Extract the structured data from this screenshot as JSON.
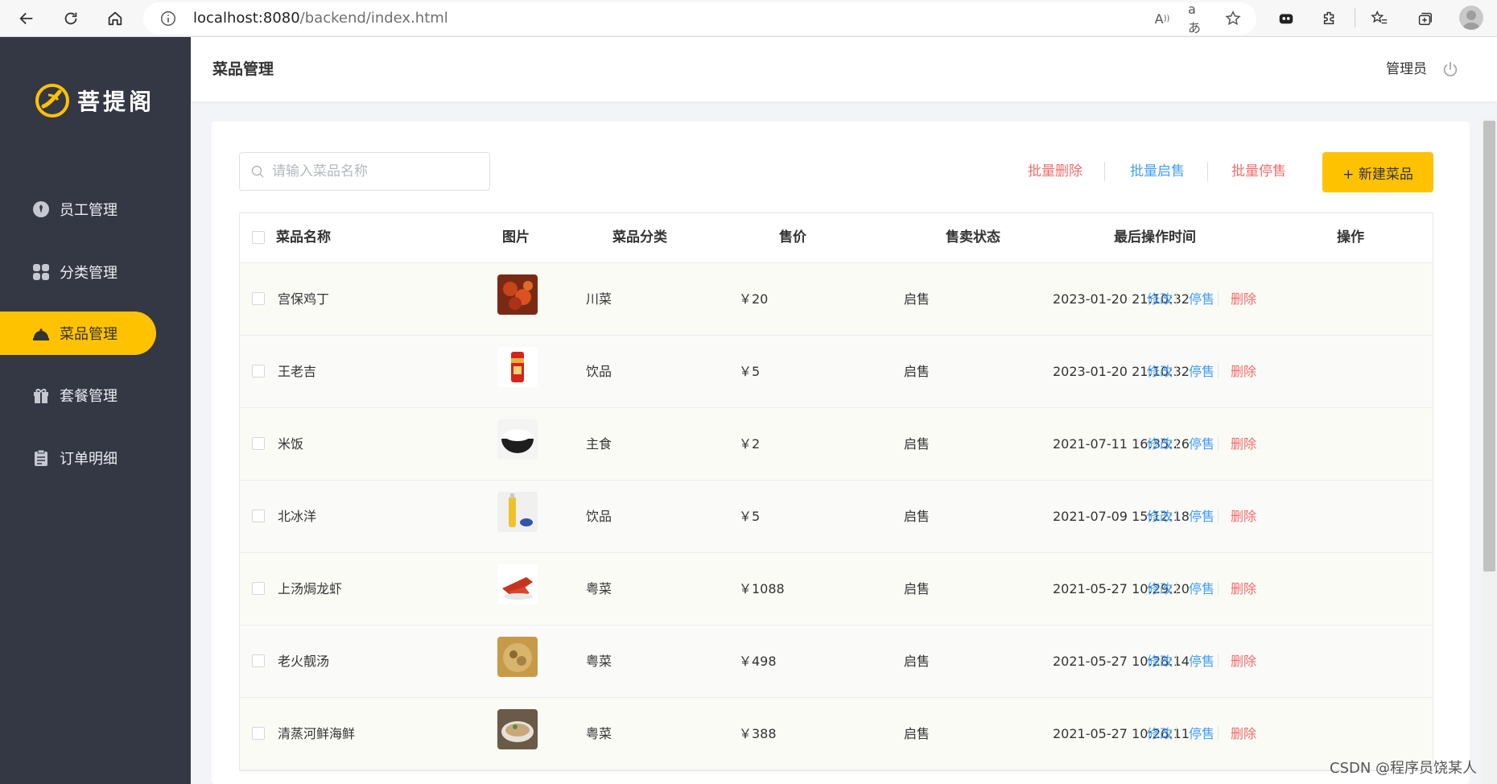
{
  "browser": {
    "url_host": "localhost:8080",
    "url_path": "/backend/index.html"
  },
  "sidebar": {
    "logo_text": "菩提阁",
    "items": [
      {
        "label": "员工管理",
        "icon": "employee-icon"
      },
      {
        "label": "分类管理",
        "icon": "category-icon"
      },
      {
        "label": "菜品管理",
        "icon": "dish-icon",
        "active": true
      },
      {
        "label": "套餐管理",
        "icon": "gift-icon"
      },
      {
        "label": "订单明细",
        "icon": "clipboard-icon"
      }
    ]
  },
  "header": {
    "title": "菜品管理",
    "user": "管理员"
  },
  "toolbar": {
    "search_placeholder": "请输入菜品名称",
    "batch_delete": "批量删除",
    "batch_enable": "批量启售",
    "batch_disable": "批量停售",
    "new_dish": "+ 新建菜品"
  },
  "table": {
    "columns": [
      "菜品名称",
      "图片",
      "菜品分类",
      "售价",
      "售卖状态",
      "最后操作时间",
      "操作"
    ],
    "rows": [
      {
        "name": "宫保鸡丁",
        "category": "川菜",
        "price": "￥20",
        "status": "启售",
        "time": "2023-01-20 21:10:32",
        "img": "spicy-dish"
      },
      {
        "name": "王老吉",
        "category": "饮品",
        "price": "￥5",
        "status": "启售",
        "time": "2023-01-20 21:10:32",
        "img": "red-can"
      },
      {
        "name": "米饭",
        "category": "主食",
        "price": "￥2",
        "status": "启售",
        "time": "2021-07-11 16:35:26",
        "img": "rice-bowl"
      },
      {
        "name": "北冰洋",
        "category": "饮品",
        "price": "￥5",
        "status": "启售",
        "time": "2021-07-09 15:12:18",
        "img": "soda-bottle"
      },
      {
        "name": "上汤焗龙虾",
        "category": "粤菜",
        "price": "￥1088",
        "status": "启售",
        "time": "2021-05-27 10:29:20",
        "img": "lobster"
      },
      {
        "name": "老火靓汤",
        "category": "粤菜",
        "price": "￥498",
        "status": "启售",
        "time": "2021-05-27 10:28:14",
        "img": "soup"
      },
      {
        "name": "清蒸河鲜海鲜",
        "category": "粤菜",
        "price": "￥388",
        "status": "启售",
        "time": "2021-05-27 10:26:11",
        "img": "seafood"
      }
    ],
    "ops": {
      "edit": "修改",
      "disable": "停售",
      "delete": "删除"
    }
  },
  "watermark": "CSDN @程序员饶某人",
  "colors": {
    "sidebar_bg": "#343744",
    "accent": "#ffc200",
    "link_blue": "#419eff",
    "link_red": "#f56c6c"
  }
}
